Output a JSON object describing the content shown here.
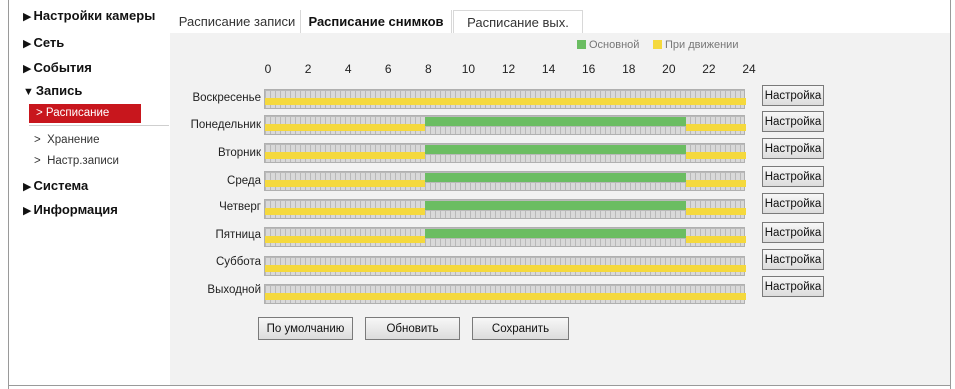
{
  "sidebar": {
    "items": [
      {
        "label": "Настройки камеры",
        "arrow": "▶"
      },
      {
        "label": "Сеть",
        "arrow": "▶"
      },
      {
        "label": "События",
        "arrow": "▶"
      },
      {
        "label": "Запись",
        "arrow": "▼"
      },
      {
        "label": "Система",
        "arrow": "▶"
      },
      {
        "label": "Информация",
        "arrow": "▶"
      }
    ],
    "record_sub": [
      {
        "label": "Расписание",
        "prefix": ">"
      },
      {
        "label": "Хранение",
        "prefix": ">"
      },
      {
        "label": "Настр.записи",
        "prefix": ">"
      }
    ]
  },
  "tabs": [
    {
      "label": "Расписание записи"
    },
    {
      "label": "Расписание снимков"
    },
    {
      "label": "Расписание вых."
    }
  ],
  "legend": {
    "main": {
      "label": "Основной",
      "color": "#6bbd62"
    },
    "motion": {
      "label": "При движении",
      "color": "#f5d93d"
    }
  },
  "hours": [
    "0",
    "2",
    "4",
    "6",
    "8",
    "10",
    "12",
    "14",
    "16",
    "18",
    "20",
    "22",
    "24"
  ],
  "days": [
    {
      "label": "Воскресенье",
      "segments": [
        {
          "start": 0,
          "end": 24,
          "type": "motion"
        }
      ]
    },
    {
      "label": "Понедельник",
      "segments": [
        {
          "start": 0,
          "end": 8,
          "type": "motion"
        },
        {
          "start": 8,
          "end": 21,
          "type": "main"
        },
        {
          "start": 21,
          "end": 24,
          "type": "motion"
        }
      ]
    },
    {
      "label": "Вторник",
      "segments": [
        {
          "start": 0,
          "end": 8,
          "type": "motion"
        },
        {
          "start": 8,
          "end": 21,
          "type": "main"
        },
        {
          "start": 21,
          "end": 24,
          "type": "motion"
        }
      ]
    },
    {
      "label": "Среда",
      "segments": [
        {
          "start": 0,
          "end": 8,
          "type": "motion"
        },
        {
          "start": 8,
          "end": 21,
          "type": "main"
        },
        {
          "start": 21,
          "end": 24,
          "type": "motion"
        }
      ]
    },
    {
      "label": "Четверг",
      "segments": [
        {
          "start": 0,
          "end": 8,
          "type": "motion"
        },
        {
          "start": 8,
          "end": 21,
          "type": "main"
        },
        {
          "start": 21,
          "end": 24,
          "type": "motion"
        }
      ]
    },
    {
      "label": "Пятница",
      "segments": [
        {
          "start": 0,
          "end": 8,
          "type": "motion"
        },
        {
          "start": 8,
          "end": 21,
          "type": "main"
        },
        {
          "start": 21,
          "end": 24,
          "type": "motion"
        }
      ]
    },
    {
      "label": "Суббота",
      "segments": [
        {
          "start": 0,
          "end": 24,
          "type": "motion"
        }
      ]
    },
    {
      "label": "Выходной",
      "segments": [
        {
          "start": 0,
          "end": 24,
          "type": "motion"
        }
      ]
    }
  ],
  "setup_button_label": "Настройка",
  "buttons": {
    "default": "По умолчанию",
    "refresh": "Обновить",
    "save": "Сохранить"
  }
}
